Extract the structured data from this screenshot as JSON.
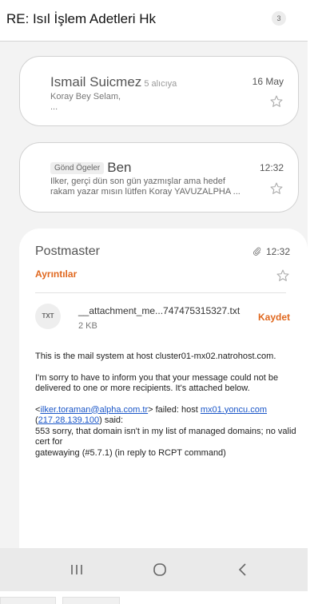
{
  "header": {
    "title": "RE: Isıl İşlem Adetleri Hk",
    "message_count": "3"
  },
  "messages": [
    {
      "sender": "Ismail Suicmez",
      "recipients": "5 alıcıya",
      "date": "16 May",
      "snippet_line1": "Koray Bey Selam,",
      "snippet_line2": "...",
      "starred": false
    },
    {
      "chip": "Gönd Ögeler",
      "sender": "Ben",
      "date": "12:32",
      "snippet_line1": "Ilker, gerçi dün son gün yazmışlar ama hedef",
      "snippet_line2": "rakam yazar mısın lütfen Koray YAVUZALPHA ...",
      "starred": false
    }
  ],
  "open_message": {
    "sender": "Postmaster",
    "time": "12:32",
    "details_label": "Ayrıntılar",
    "starred": false,
    "attachment": {
      "type_label": "TXT",
      "name": "__attachment_me...747475315327.txt",
      "size": "2 KB",
      "save_label": "Kaydet"
    },
    "body": {
      "p1": "This is the mail system at host cluster01-mx02.natrohost.com.",
      "p2": "I'm sorry to have to inform you that your message could not be delivered to one or more recipients. It's attached below.",
      "p3_open": "<",
      "p3_email": "ilker.toraman@alpha.com.tr",
      "p3_mid": "> failed: host ",
      "p3_host": "mx01.yoncu.com",
      "p3_open2": " (",
      "p3_ip": "217.28.139.100",
      "p3_said": ") said:",
      "p3_line2": "553 sorry, that domain isn't in my list of managed domains; no valid cert for",
      "p3_line3": "gatewaying (#5.7.1) (in reply to RCPT command)"
    }
  },
  "navbar": {
    "recent_icon": "recent-apps-icon",
    "home_icon": "home-icon",
    "back_icon": "back-icon"
  },
  "colors": {
    "accent": "#e0681f",
    "link": "#1a56c8",
    "background": "#f3f3f3"
  }
}
